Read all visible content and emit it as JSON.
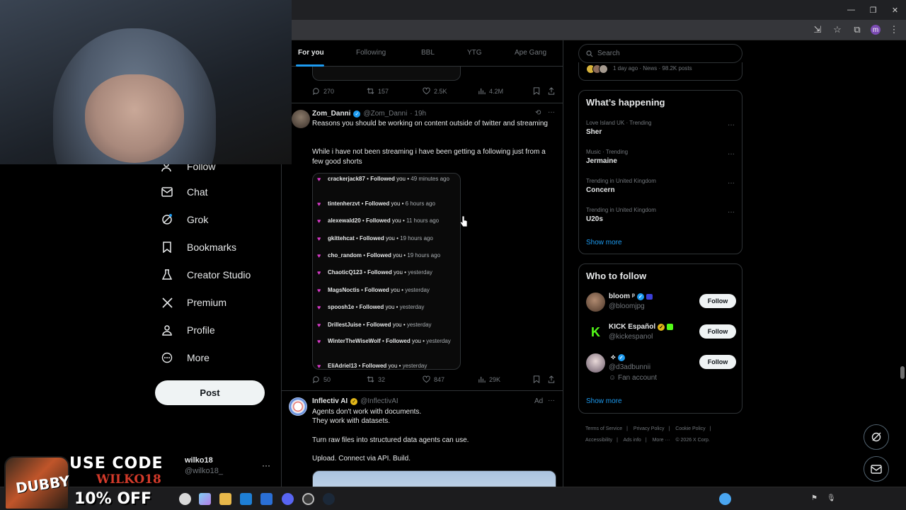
{
  "browser": {
    "window_controls": [
      "—",
      "❐",
      "✕"
    ],
    "profile_initial": "m"
  },
  "promo": {
    "line1": "USE CODE",
    "line2": "WILKO18",
    "line3": "10% OFF",
    "can_label": "DUBBY"
  },
  "nav": {
    "items": [
      {
        "label": "Follow",
        "icon": "person-plus-icon"
      },
      {
        "label": "Chat",
        "icon": "envelope-icon"
      },
      {
        "label": "Grok",
        "icon": "grok-icon"
      },
      {
        "label": "Bookmarks",
        "icon": "bookmark-icon"
      },
      {
        "label": "Creator Studio",
        "icon": "creator-studio-icon"
      },
      {
        "label": "Premium",
        "icon": "x-logo-icon"
      },
      {
        "label": "Profile",
        "icon": "person-icon"
      },
      {
        "label": "More",
        "icon": "more-circle-icon"
      }
    ],
    "post_label": "Post"
  },
  "account": {
    "name": "wilko18",
    "handle": "@wilko18_",
    "more": "···"
  },
  "tabs": [
    {
      "label": "For you",
      "active": true
    },
    {
      "label": "Following",
      "active": false
    },
    {
      "label": "BBL",
      "active": false
    },
    {
      "label": "YTG",
      "active": false
    },
    {
      "label": "Ape Gang",
      "active": false
    }
  ],
  "prev_tweet": {
    "replies": "270",
    "reposts": "157",
    "likes": "2.5K",
    "views": "4.2M"
  },
  "tweet": {
    "name": "Zom_Danni",
    "handle": "@Zom_Danni",
    "time": "· 19h",
    "text1": "Reasons you should be working on content outside of twitter and streaming",
    "text2": "While i have not been streaming i have been getting a following just from a few good shorts",
    "follows": [
      {
        "user": "crackerjack87",
        "time": "49 minutes ago"
      },
      {
        "user": "tintenherzvt",
        "time": "6 hours ago"
      },
      {
        "user": "alexewald20",
        "time": "11 hours ago"
      },
      {
        "user": "gkittehcat",
        "time": "19 hours ago"
      },
      {
        "user": "cho_random",
        "time": "19 hours ago"
      },
      {
        "user": "ChaoticQ123",
        "time": "yesterday"
      },
      {
        "user": "MagsNoctis",
        "time": "yesterday"
      },
      {
        "user": "spoosh1e",
        "time": "yesterday"
      },
      {
        "user": "DrillestJuise",
        "time": "yesterday"
      },
      {
        "user": "WinterTheWiseWolf",
        "time": "yesterday"
      },
      {
        "user": "EliAdriel13",
        "time": "yesterday"
      }
    ],
    "followed_word": "Followed",
    "you_word": "you",
    "bullet": "•",
    "replies": "50",
    "reposts": "32",
    "likes": "847",
    "views": "29K"
  },
  "ad": {
    "name": "Inflectiv AI",
    "handle": "@InflectivAI",
    "ad_label": "Ad",
    "line1": "Agents don't work with documents.",
    "line2": "They work with datasets.",
    "line3": "Turn raw files into structured data agents can use.",
    "line4": "Upload. Connect via API. Build."
  },
  "search": {
    "placeholder": "Search"
  },
  "top_news": {
    "meta": "1 day ago · News · 98.2K posts"
  },
  "happening": {
    "title": "What’s happening",
    "trends": [
      {
        "context": "Love Island UK · Trending",
        "title": "Sher"
      },
      {
        "context": "Music · Trending",
        "title": "Jermaine"
      },
      {
        "context": "Trending in United Kingdom",
        "title": "Concern"
      },
      {
        "context": "Trending in United Kingdom",
        "title": "U20s"
      }
    ],
    "show_more": "Show more"
  },
  "who_to_follow": {
    "title": "Who to follow",
    "accounts": [
      {
        "name": "bloom",
        "handle": "@bloomjpg",
        "extra": ""
      },
      {
        "name": "KICK Español",
        "handle": "@kickespanol",
        "extra": ""
      },
      {
        "name": "",
        "handle": "@d3adbunnii",
        "extra": "Fan account"
      }
    ],
    "follow_label": "Follow",
    "show_more": "Show more"
  },
  "footer": {
    "links": [
      "Terms of Service",
      "|",
      "Privacy Policy",
      "|",
      "Cookie Policy",
      "|",
      "Accessibility",
      "|",
      "Ads info",
      "|",
      "More ···",
      "© 2026 X Corp."
    ]
  },
  "colors": {
    "accent": "#1d9bf0",
    "heart": "#d83ac8",
    "background": "#000000"
  }
}
